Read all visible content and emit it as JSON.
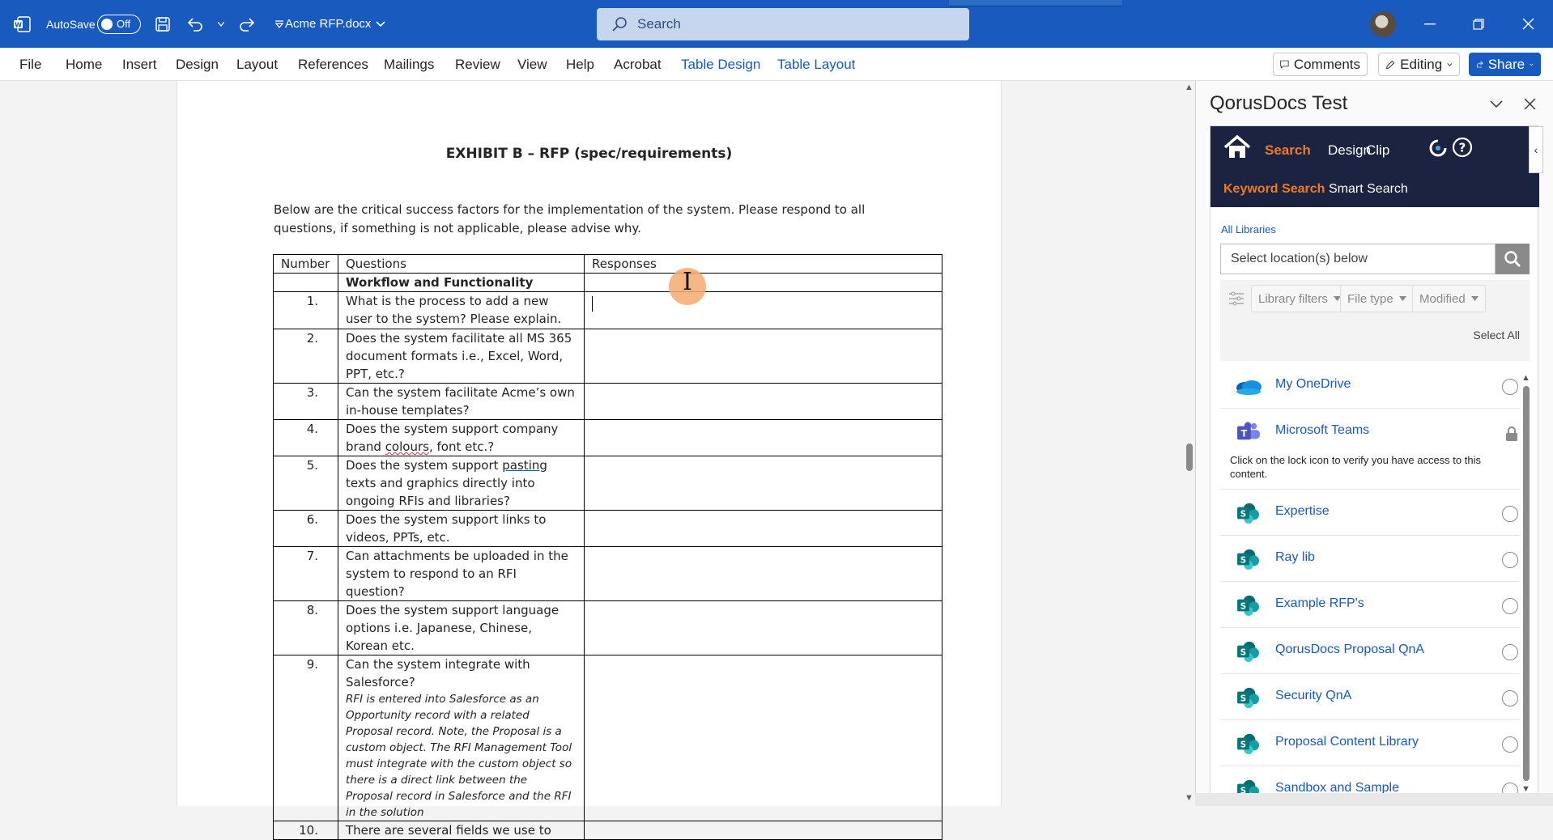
{
  "titlebar": {
    "autosave_label": "AutoSave",
    "autosave_state": "Off",
    "document_title": "Acme RFP.docx",
    "search_placeholder": "Search"
  },
  "ribbon": {
    "tabs": [
      "File",
      "Home",
      "Insert",
      "Design",
      "Layout",
      "References",
      "Mailings",
      "Review",
      "View",
      "Help",
      "Acrobat",
      "Table Design",
      "Table Layout"
    ],
    "comments_label": "Comments",
    "editing_label": "Editing",
    "share_label": "Share"
  },
  "document": {
    "heading": "EXHIBIT B – RFP (spec/requirements)",
    "intro": "Below are the critical success factors for the implementation of the system. Please respond to all questions, if something is not applicable, please advise why.",
    "table": {
      "headers": [
        "Number",
        "Questions",
        "Responses"
      ],
      "section": "Workflow and Functionality",
      "rows": [
        {
          "num": "1.",
          "q": "What is the process to add a new user to the system? Please explain."
        },
        {
          "num": "2.",
          "q": "Does the system facilitate all MS 365 document formats i.e., Excel, Word, PPT, etc.?"
        },
        {
          "num": "3.",
          "q": "Can the system facilitate Acme’s own in-house templates?"
        },
        {
          "num": "4.",
          "q_a": "Does the system support company brand ",
          "q_b": "colours",
          "q_c": ", font etc.?"
        },
        {
          "num": "5.",
          "q_a": "Does the system support ",
          "q_b": "pasting",
          "q_c": " texts and graphics directly into ongoing RFIs and libraries?"
        },
        {
          "num": "6.",
          "q": "Does the system support links to videos, PPTs, etc."
        },
        {
          "num": "7.",
          "q": "Can attachments be uploaded in the system to respond to an RFI question?"
        },
        {
          "num": "8.",
          "q": "Does the system support language options i.e. Japanese, Chinese, Korean etc."
        },
        {
          "num": "9.",
          "q": "Can the system integrate with Salesforce?",
          "note": "RFI is entered into Salesforce as an Opportunity record with a related Proposal record. Note, the Proposal is a custom object. The RFI Management Tool must integrate with the custom object so there is a direct link between the Proposal record in Salesforce and the RFI in the solution"
        },
        {
          "num": "10.",
          "q": "There are several fields we use to"
        }
      ]
    }
  },
  "pane": {
    "title": "QorusDocs Test",
    "nav_tabs": [
      "Search",
      "Design",
      "Clip"
    ],
    "sub_tabs": [
      "Keyword Search",
      "Smart Search"
    ],
    "all_libraries": "All Libraries",
    "location_placeholder": "Select location(s) below",
    "filters": [
      "Library filters",
      "File type",
      "Modified"
    ],
    "select_all": "Select All",
    "libraries": [
      {
        "name": "My OneDrive",
        "icon": "onedrive-icon"
      },
      {
        "name": "Microsoft Teams",
        "icon": "teams-icon",
        "locked": true,
        "note": "Click on the lock icon to verify you have access to this content."
      },
      {
        "name": "Expertise",
        "icon": "sharepoint-icon"
      },
      {
        "name": "Ray lib",
        "icon": "sharepoint-icon"
      },
      {
        "name": "Example RFP's",
        "icon": "sharepoint-icon"
      },
      {
        "name": "QorusDocs Proposal QnA",
        "icon": "sharepoint-icon"
      },
      {
        "name": "Security QnA",
        "icon": "sharepoint-icon"
      },
      {
        "name": "Proposal Content Library",
        "icon": "sharepoint-icon"
      },
      {
        "name": "Sandbox and Sample",
        "icon": "sharepoint-icon"
      }
    ]
  },
  "colors": {
    "word_blue": "#185abd",
    "qorus_navy": "#1b2340",
    "qorus_orange": "#f07a24"
  }
}
